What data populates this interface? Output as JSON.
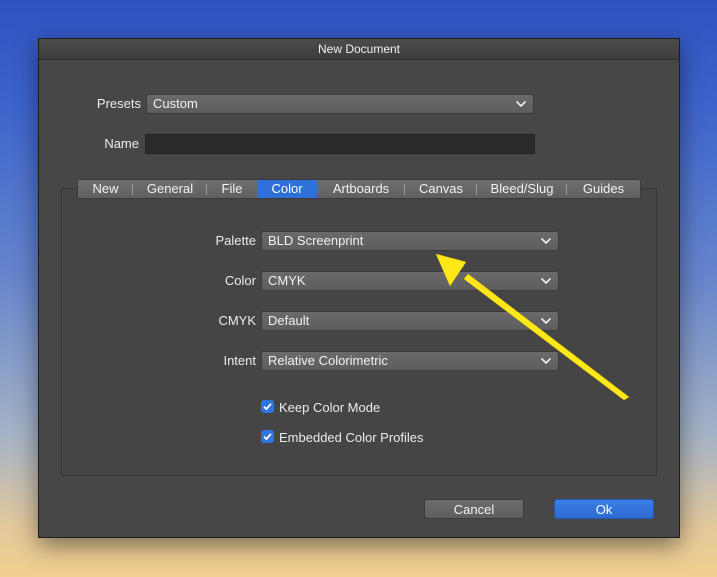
{
  "window": {
    "title": "New Document"
  },
  "presets": {
    "label": "Presets",
    "value": "Custom"
  },
  "name_field": {
    "label": "Name",
    "value": ""
  },
  "tabs": [
    {
      "label": "New",
      "active": false
    },
    {
      "label": "General",
      "active": false
    },
    {
      "label": "File",
      "active": false
    },
    {
      "label": "Color",
      "active": true
    },
    {
      "label": "Artboards",
      "active": false
    },
    {
      "label": "Canvas",
      "active": false
    },
    {
      "label": "Bleed/Slug",
      "active": false
    },
    {
      "label": "Guides",
      "active": false
    }
  ],
  "color_settings": {
    "palette": {
      "label": "Palette",
      "value": "BLD Screenprint"
    },
    "color": {
      "label": "Color",
      "value": "CMYK"
    },
    "cmyk": {
      "label": "CMYK",
      "value": "Default"
    },
    "intent": {
      "label": "Intent",
      "value": "Relative Colorimetric"
    }
  },
  "checkboxes": [
    {
      "label": "Keep Color Mode",
      "checked": true
    },
    {
      "label": "Embedded Color Profiles",
      "checked": true
    }
  ],
  "buttons": {
    "cancel": "Cancel",
    "ok": "Ok"
  },
  "annotation": {
    "color": "#ffe81a"
  },
  "colors": {
    "accent": "#2e6fd8",
    "dialog_bg": "#474747"
  }
}
